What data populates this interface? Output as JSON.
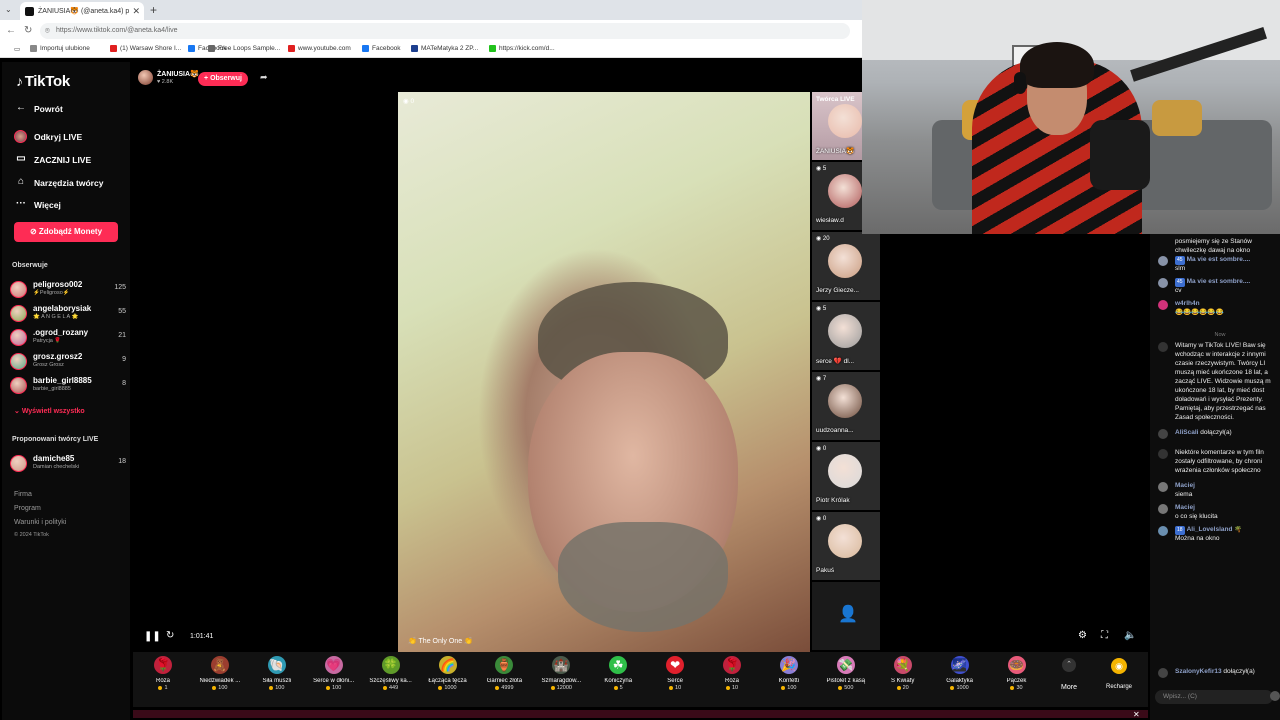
{
  "browser": {
    "tab_title": "ŻANIUSIA🐯 (@aneta.ka4) p",
    "url": "https://www.tiktok.com/@aneta.ka4/live",
    "bookmarks": [
      {
        "label": "Importuj ulubione",
        "color": "#888888"
      },
      {
        "label": "(1) Warsaw Shore I...",
        "color": "#e02020"
      },
      {
        "label": "Facebook",
        "color": "#1877f2"
      },
      {
        "label": "Free Loops Sample...",
        "color": "#666666"
      },
      {
        "label": "www.youtube.com",
        "color": "#e02020"
      },
      {
        "label": "Facebook",
        "color": "#1877f2"
      },
      {
        "label": "MATeMatyka 2 ZP...",
        "color": "#1d3f8f"
      },
      {
        "label": "https://kick.com/d...",
        "color": "#21c21c"
      }
    ]
  },
  "sidebar": {
    "logo": "TikTok",
    "back": "Powrót",
    "nav": [
      {
        "label": "Odkryj LIVE",
        "icon": "live-avatar-icon"
      },
      {
        "label": "ZACZNIJ LIVE",
        "icon": "camera-icon"
      },
      {
        "label": "Narzędzia twórcy",
        "icon": "home-icon"
      },
      {
        "label": "Więcej",
        "icon": "more-dots-icon"
      }
    ],
    "coins_button": "Zdobądź Monety",
    "following_title": "Obserwuje",
    "following": [
      {
        "name": "peligroso002",
        "sub": "⚡Peligroso⚡",
        "count": "125",
        "color": "#c77"
      },
      {
        "name": "angelaborysiak",
        "sub": "🌟 A N G E L A 🌟",
        "count": "55",
        "color": "#8a5"
      },
      {
        "name": ".ogrod_rozany",
        "sub": "Patrycja 🌹",
        "count": "21",
        "color": "#b69"
      },
      {
        "name": "grosz.grosz2",
        "sub": "Grosz Grosz",
        "count": "9",
        "color": "#5a8"
      },
      {
        "name": "barbie_girl8885",
        "sub": "barbie_girl8885",
        "count": "8",
        "color": "#a55"
      }
    ],
    "show_all": "Wyświetl wszystko",
    "suggested_title": "Proponowani twórcy LIVE",
    "suggested": [
      {
        "name": "damiche85",
        "sub": "Damian chechelski",
        "count": "18",
        "color": "#c98"
      }
    ],
    "footer": [
      "Firma",
      "Program",
      "Warunki i polityki"
    ],
    "copyright": "© 2024 TikTok"
  },
  "streamer": {
    "name": "ŻANIUSIA🐯",
    "likes": "♥ 2.8K",
    "follow_button": "+ Obserwuj"
  },
  "video": {
    "viewer_count": "0",
    "bottom_tag": "👏 The Only One 👏",
    "time": "1:01:41"
  },
  "guests": [
    {
      "header": "Twórca LIVE",
      "name": "ŻANIUSIA🐯",
      "count": "",
      "face": "#e8b9a9"
    },
    {
      "header": "",
      "name": "wiesław.d",
      "count": "5",
      "face": "#b05a5a"
    },
    {
      "header": "",
      "name": "Jerzy Giecze...",
      "count": "20",
      "face": "#c99c80"
    },
    {
      "header": "",
      "name": "serce 💔 dl...",
      "count": "5",
      "face": "#9a9a9a"
    },
    {
      "header": "",
      "name": "uudzoanna...",
      "count": "7",
      "face": "#6a4a3a"
    },
    {
      "header": "",
      "name": "Piotr Królak",
      "count": "0",
      "face": "#d9d9d9"
    },
    {
      "header": "",
      "name": "Pakuś",
      "count": "0",
      "face": "#d8b89a"
    }
  ],
  "gifts": [
    {
      "name": "Róża",
      "price": "1",
      "icon": "🌹",
      "color": "#c0213c"
    },
    {
      "name": "Niedźwiadek ...",
      "price": "100",
      "icon": "🧸",
      "color": "#9b3d2f"
    },
    {
      "name": "Siła muszli",
      "price": "100",
      "icon": "🐚",
      "color": "#2f9ab3"
    },
    {
      "name": "Serce w dłoni...",
      "price": "100",
      "icon": "💗",
      "color": "#c76aa1"
    },
    {
      "name": "Szczęśliwy ka...",
      "price": "449",
      "icon": "🍀",
      "color": "#5f9a2a"
    },
    {
      "name": "Łącząca tęcza",
      "price": "1000",
      "icon": "🌈",
      "color": "#c8b02b"
    },
    {
      "name": "Garniec złota",
      "price": "4999",
      "icon": "🏺",
      "color": "#3a8a3a"
    },
    {
      "name": "Szmaragdow...",
      "price": "12000",
      "icon": "🏰",
      "color": "#4b5a4b"
    },
    {
      "name": "Koniczyna",
      "price": "5",
      "icon": "☘",
      "color": "#2fbf49"
    },
    {
      "name": "Serce",
      "price": "10",
      "icon": "❤",
      "color": "#e0202c"
    },
    {
      "name": "Róża",
      "price": "10",
      "icon": "🌹",
      "color": "#c0213c"
    },
    {
      "name": "Konfetti",
      "price": "100",
      "icon": "🎉",
      "color": "#8b7fd6"
    },
    {
      "name": "Pistolet z kasą",
      "price": "500",
      "icon": "💸",
      "color": "#d77bb8"
    },
    {
      "name": "S Kwiaty",
      "price": "20",
      "icon": "💐",
      "color": "#c94a6a"
    },
    {
      "name": "Galaktyka",
      "price": "1000",
      "icon": "🌌",
      "color": "#3f4fcf"
    },
    {
      "name": "Pączek",
      "price": "30",
      "icon": "🍩",
      "color": "#e85a7a"
    }
  ],
  "more_label": "More",
  "recharge_label": "Recharge",
  "chat": {
    "messages": [
      {
        "user": "",
        "badge": "",
        "text": "posmiejemy się ze Stanów",
        "av": ""
      },
      {
        "user": "",
        "badge": "",
        "text": "chwileczkę dawaj na okno",
        "av": ""
      },
      {
        "user": "Ma vie est sombre....",
        "badge": "45",
        "text": "slm",
        "av": "#8893a8"
      },
      {
        "user": "Ma vie est sombre....",
        "badge": "45",
        "text": "cv",
        "av": "#8893a8"
      },
      {
        "user": "w4rlh4n",
        "badge": "",
        "text": "😂😂😂😂😂😂",
        "av": "#d2327a"
      },
      {
        "user": "",
        "badge": "",
        "text": "Witamy w TikTok LIVE! Baw się",
        "av": "#333333"
      },
      {
        "user": "",
        "badge": "",
        "text": "wchodząc w interakcje z innymi",
        "av": ""
      },
      {
        "user": "",
        "badge": "",
        "text": "czasie rzeczywistym. Twórcy LI",
        "av": ""
      },
      {
        "user": "",
        "badge": "",
        "text": "muszą mieć ukończone 18 lat, a",
        "av": ""
      },
      {
        "user": "",
        "badge": "",
        "text": "zacząć LIVE. Widzowie muszą m",
        "av": ""
      },
      {
        "user": "",
        "badge": "",
        "text": "ukończone 18 lat, by mieć dost",
        "av": ""
      },
      {
        "user": "",
        "badge": "",
        "text": "doładowań i wysyłać Prezenty.",
        "av": ""
      },
      {
        "user": "",
        "badge": "",
        "text": "Pamiętaj, aby przestrzegać nas",
        "av": ""
      },
      {
        "user": "",
        "badge": "",
        "text": "Zasad społeczności.",
        "av": ""
      },
      {
        "user": "AliScali",
        "badge": "",
        "text": "dołączył(a)",
        "av": "#444444"
      },
      {
        "user": "",
        "badge": "",
        "text": "Niektóre komentarze w tym filn",
        "av": "#333333"
      },
      {
        "user": "",
        "badge": "",
        "text": "zostały odfiltrowane, by chroni",
        "av": ""
      },
      {
        "user": "",
        "badge": "",
        "text": "wrażenia członków społeczno",
        "av": ""
      },
      {
        "user": "Maciej",
        "badge": "",
        "text": "siema",
        "av": "#777777"
      },
      {
        "user": "Maciej",
        "badge": "",
        "text": "o co się klucita",
        "av": "#777777"
      },
      {
        "user": "Ali_Lovelsland 🌴",
        "badge": "18",
        "text": "Można na okno",
        "av": "#6a8fb0"
      },
      {
        "user": "SzalonyKefir13",
        "badge": "",
        "text": "dołączył(a)",
        "av": "#444444"
      }
    ],
    "divider": "Now",
    "input_placeholder": "Wpisz... (C)"
  }
}
